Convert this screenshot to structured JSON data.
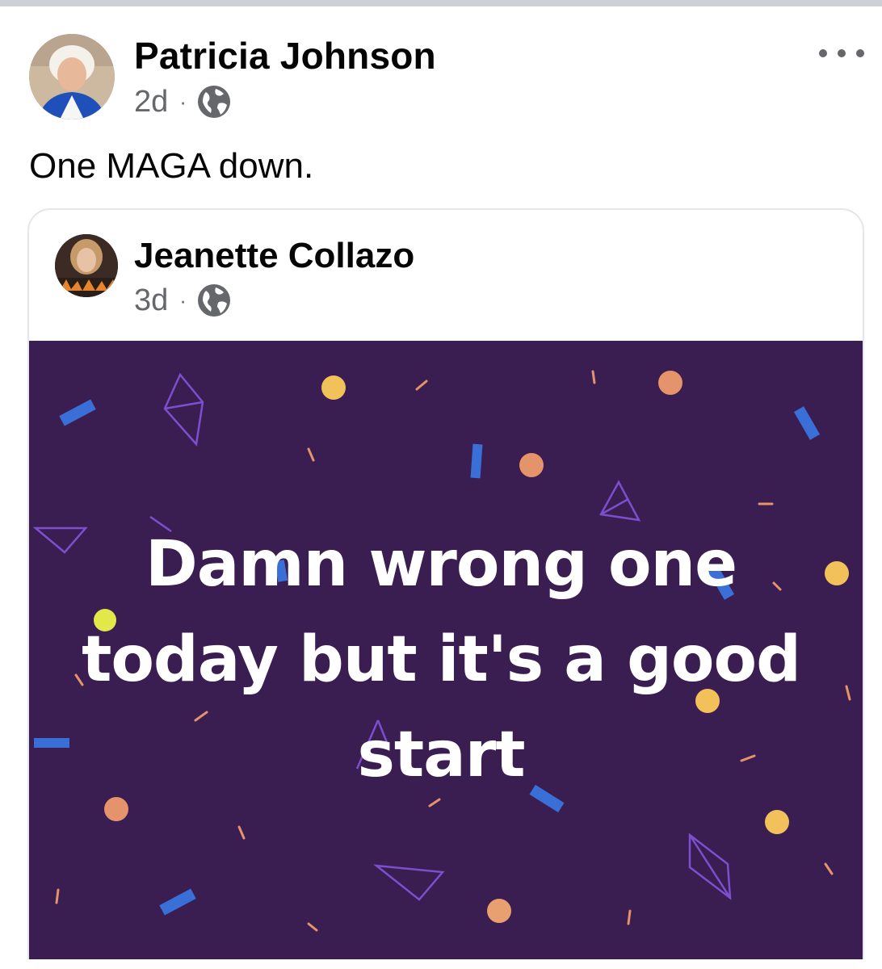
{
  "post": {
    "author_name": "Patricia Johnson",
    "timestamp": "2d",
    "separator": "·",
    "audience_icon": "globe-icon",
    "more_icon": "more-options-icon",
    "text": "One MAGA down."
  },
  "shared_post": {
    "author_name": "Jeanette Collazo",
    "timestamp": "3d",
    "separator": "·",
    "audience_icon": "globe-icon",
    "background_text": "Damn wrong one today but it's a good start",
    "background_color": "#3a1d51",
    "confetti_colors": [
      "#7d4fcf",
      "#3a6fd8",
      "#f2c15a",
      "#e4936a"
    ]
  },
  "colors": {
    "secondary_text": "#65676b",
    "divider": "#cfd0d6",
    "card_border": "#e4e6eb"
  }
}
